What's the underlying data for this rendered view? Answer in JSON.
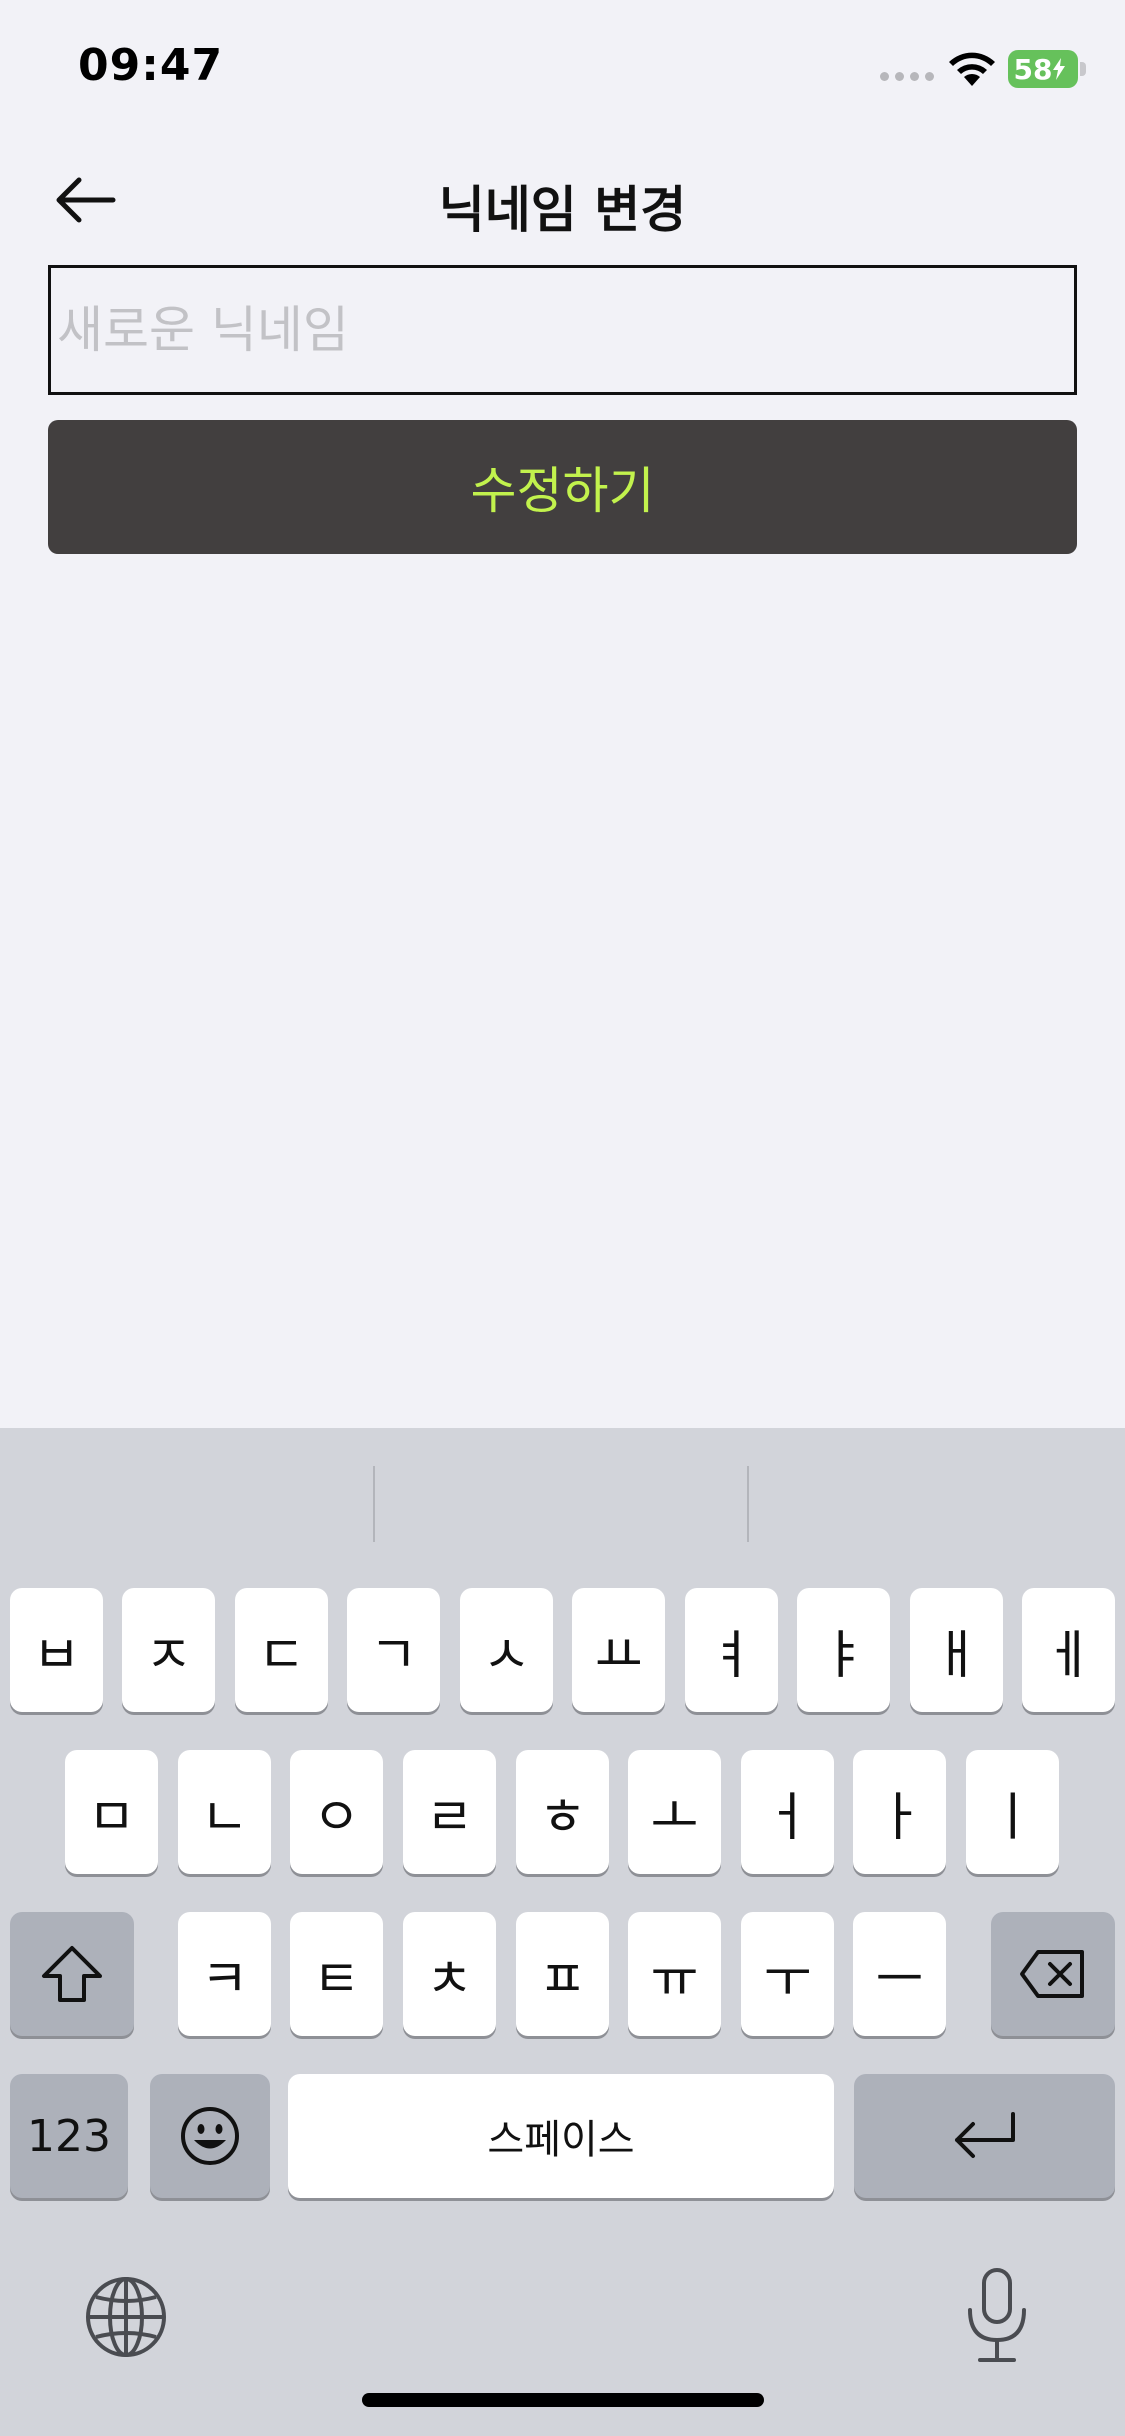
{
  "status_bar": {
    "time": "09:47",
    "battery": "58"
  },
  "header": {
    "title": "닉네임 변경"
  },
  "form": {
    "input_value": "",
    "input_placeholder": "새로운 닉네임",
    "submit_label": "수정하기"
  },
  "colors": {
    "background": "#f2f2f7",
    "button_bg": "#423f3f",
    "button_text": "#c2f24d",
    "battery": "#66c15b"
  },
  "keyboard": {
    "row1": [
      "ㅂ",
      "ㅈ",
      "ㄷ",
      "ㄱ",
      "ㅅ",
      "ㅛ",
      "ㅕ",
      "ㅑ",
      "ㅐ",
      "ㅔ"
    ],
    "row2": [
      "ㅁ",
      "ㄴ",
      "ㅇ",
      "ㄹ",
      "ㅎ",
      "ㅗ",
      "ㅓ",
      "ㅏ",
      "ㅣ"
    ],
    "row3": [
      "ㅋ",
      "ㅌ",
      "ㅊ",
      "ㅍ",
      "ㅠ",
      "ㅜ",
      "ㅡ"
    ],
    "numbers_label": "123",
    "space_label": "스페이스"
  },
  "icons": {
    "back": "arrow-left-icon",
    "shift": "shift-icon",
    "delete": "backspace-icon",
    "emoji": "emoji-icon",
    "return": "return-icon",
    "globe": "globe-icon",
    "mic": "microphone-icon",
    "wifi": "wifi-icon"
  }
}
